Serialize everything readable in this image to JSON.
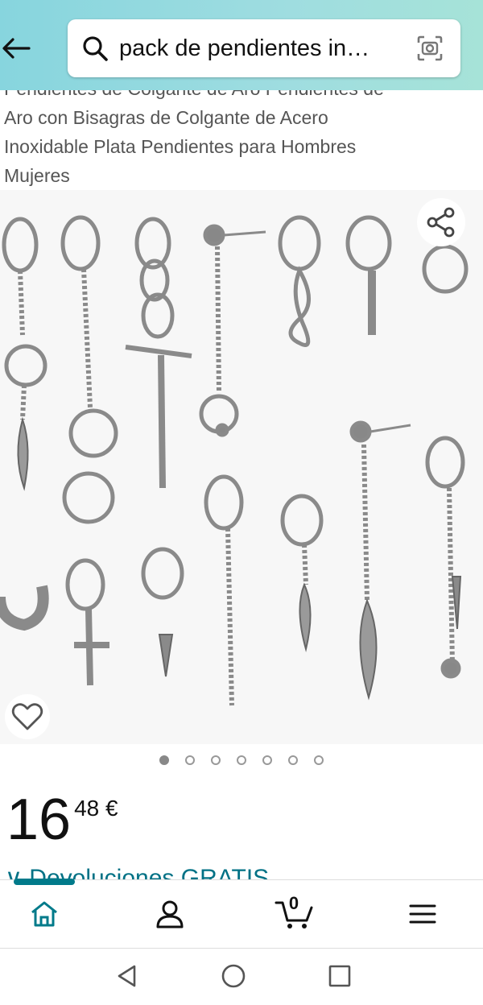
{
  "search": {
    "query": "pack de pendientes in…"
  },
  "product": {
    "title_lines": [
      "Pendientes de Colgante de Aro Pendientes de",
      "Aro con Bisagras de Colgante de Acero",
      "Inoxidable Plata Pendientes para Hombres",
      "Mujeres"
    ],
    "price_whole": "16",
    "price_fraction": "48 €",
    "returns_text": "∨ Devoluciones GRATIS"
  },
  "gallery": {
    "total_images": 7,
    "active_index": 0
  },
  "nav": {
    "cart_count": "0"
  },
  "colors": {
    "accent": "#007185",
    "header_start": "#87d5de",
    "header_end": "#a6e3d8",
    "nav_indicator": "#007a8a"
  }
}
